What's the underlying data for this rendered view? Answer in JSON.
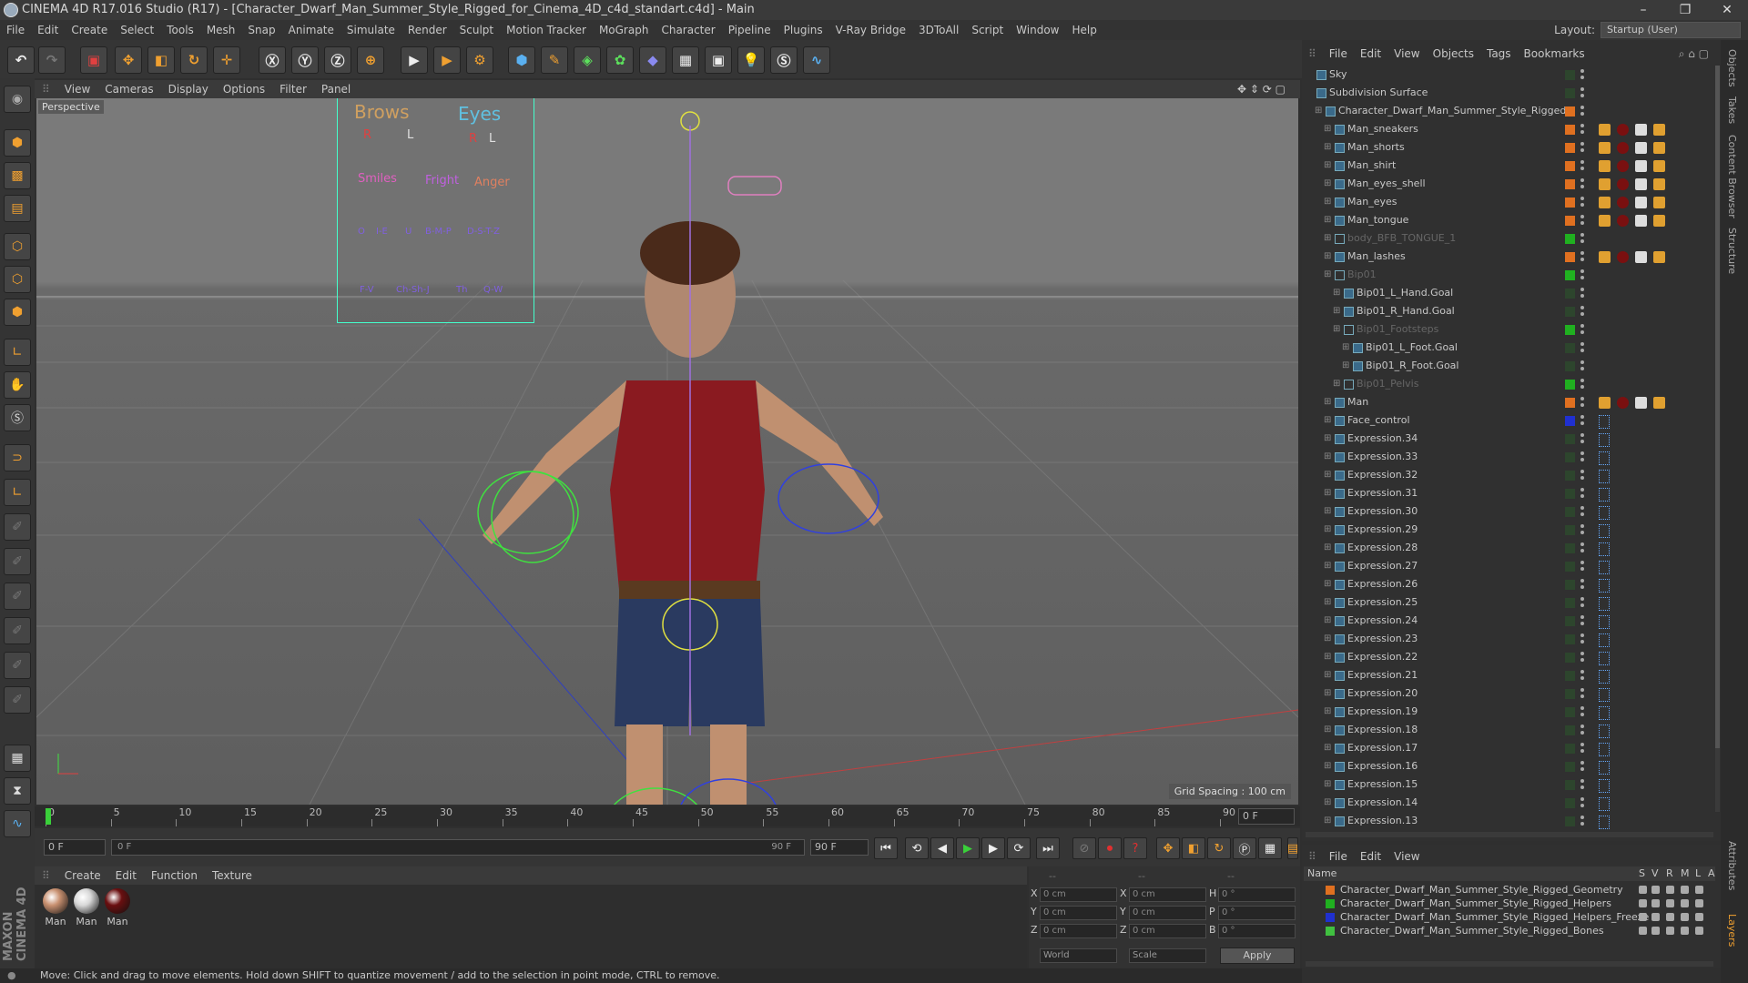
{
  "window": {
    "title": "CINEMA 4D R17.016 Studio (R17) - [Character_Dwarf_Man_Summer_Style_Rigged_for_Cinema_4D_c4d_standart.c4d] - Main",
    "controls": [
      "–",
      "❐",
      "✕"
    ]
  },
  "menu": [
    "File",
    "Edit",
    "Create",
    "Select",
    "Tools",
    "Mesh",
    "Snap",
    "Animate",
    "Simulate",
    "Render",
    "Sculpt",
    "Motion Tracker",
    "MoGraph",
    "Character",
    "Pipeline",
    "Plugins",
    "V-Ray Bridge",
    "3DToAll",
    "Script",
    "Window",
    "Help"
  ],
  "layout": {
    "label": "Layout:",
    "value": "Startup (User)"
  },
  "viewport": {
    "menu": [
      "View",
      "Cameras",
      "Display",
      "Options",
      "Filter",
      "Panel"
    ],
    "camera_label": "Perspective",
    "grid_spacing": "Grid Spacing : 100 cm",
    "face_controls": {
      "brows": "Brows",
      "eyes": "Eyes",
      "r1": "R",
      "l1": "L",
      "r2": "R",
      "l2": "L",
      "smiles": "Smiles",
      "fright": "Fright",
      "anger": "Anger",
      "phonemes1": [
        "O",
        "I-E",
        "U",
        "B-M-P",
        "D-S-T-Z"
      ],
      "phonemes2": [
        "F-V",
        "Ch-Sh-J",
        "Th",
        "Q-W"
      ]
    }
  },
  "timeline": {
    "ticks": [
      "0",
      "5",
      "10",
      "15",
      "20",
      "25",
      "30",
      "35",
      "40",
      "45",
      "50",
      "55",
      "60",
      "65",
      "70",
      "75",
      "80",
      "85",
      "90"
    ],
    "current_frame": "0 F",
    "start_field": "0 F",
    "range_start": "0 F",
    "range_end": "90 F",
    "end_field": "90 F"
  },
  "materials": {
    "menu": [
      "Create",
      "Edit",
      "Function",
      "Texture"
    ],
    "items": [
      {
        "label": "Man",
        "color": "#c89070"
      },
      {
        "label": "Man",
        "color": "#d8d8d8"
      },
      {
        "label": "Man",
        "color": "#6a0f10"
      }
    ]
  },
  "coords": {
    "header": [
      "--",
      "--",
      "--"
    ],
    "rows": [
      {
        "a": "X",
        "av": "0 cm",
        "b": "X",
        "bv": "0 cm",
        "c": "H",
        "cv": "0 °"
      },
      {
        "a": "Y",
        "av": "0 cm",
        "b": "Y",
        "bv": "0 cm",
        "c": "P",
        "cv": "0 °"
      },
      {
        "a": "Z",
        "av": "0 cm",
        "b": "Z",
        "bv": "0 cm",
        "c": "B",
        "cv": "0 °"
      }
    ],
    "space": "World",
    "mode": "Scale",
    "apply": "Apply"
  },
  "status": "Move: Click and drag to move elements. Hold down SHIFT to quantize movement / add to the selection in point mode, CTRL to remove.",
  "object_manager": {
    "menu": [
      "File",
      "Edit",
      "View",
      "Objects",
      "Tags",
      "Bookmarks"
    ],
    "objects": [
      {
        "name": "Sky",
        "indent": 0,
        "color": "",
        "dim": false
      },
      {
        "name": "Subdivision Surface",
        "indent": 0,
        "color": "",
        "dim": false
      },
      {
        "name": "Character_Dwarf_Man_Summer_Style_Rigged",
        "indent": 1,
        "color": "#e07020",
        "dim": false
      },
      {
        "name": "Man_sneakers",
        "indent": 2,
        "color": "#e07020",
        "dim": false
      },
      {
        "name": "Man_shorts",
        "indent": 2,
        "color": "#e07020",
        "dim": false
      },
      {
        "name": "Man_shirt",
        "indent": 2,
        "color": "#e07020",
        "dim": false
      },
      {
        "name": "Man_eyes_shell",
        "indent": 2,
        "color": "#e07020",
        "dim": false
      },
      {
        "name": "Man_eyes",
        "indent": 2,
        "color": "#e07020",
        "dim": false
      },
      {
        "name": "Man_tongue",
        "indent": 2,
        "color": "#e07020",
        "dim": false
      },
      {
        "name": "body_BFB_TONGUE_1",
        "indent": 2,
        "color": "#20b020",
        "dim": true
      },
      {
        "name": "Man_lashes",
        "indent": 2,
        "color": "#e07020",
        "dim": false
      },
      {
        "name": "Bip01",
        "indent": 2,
        "color": "#20b020",
        "dim": true
      },
      {
        "name": "Bip01_L_Hand.Goal",
        "indent": 3,
        "color": "",
        "dim": false
      },
      {
        "name": "Bip01_R_Hand.Goal",
        "indent": 3,
        "color": "",
        "dim": false
      },
      {
        "name": "Bip01_Footsteps",
        "indent": 3,
        "color": "#20b020",
        "dim": true
      },
      {
        "name": "Bip01_L_Foot.Goal",
        "indent": 4,
        "color": "",
        "dim": false
      },
      {
        "name": "Bip01_R_Foot.Goal",
        "indent": 4,
        "color": "",
        "dim": false
      },
      {
        "name": "Bip01_Pelvis",
        "indent": 3,
        "color": "#20b020",
        "dim": true
      },
      {
        "name": "Man",
        "indent": 2,
        "color": "#e07020",
        "dim": false
      },
      {
        "name": "Face_control",
        "indent": 2,
        "color": "#2030d0",
        "dim": false
      },
      {
        "name": "Expression.34",
        "indent": 2,
        "color": "",
        "dim": false
      },
      {
        "name": "Expression.33",
        "indent": 2,
        "color": "",
        "dim": false
      },
      {
        "name": "Expression.32",
        "indent": 2,
        "color": "",
        "dim": false
      },
      {
        "name": "Expression.31",
        "indent": 2,
        "color": "",
        "dim": false
      },
      {
        "name": "Expression.30",
        "indent": 2,
        "color": "",
        "dim": false
      },
      {
        "name": "Expression.29",
        "indent": 2,
        "color": "",
        "dim": false
      },
      {
        "name": "Expression.28",
        "indent": 2,
        "color": "",
        "dim": false
      },
      {
        "name": "Expression.27",
        "indent": 2,
        "color": "",
        "dim": false
      },
      {
        "name": "Expression.26",
        "indent": 2,
        "color": "",
        "dim": false
      },
      {
        "name": "Expression.25",
        "indent": 2,
        "color": "",
        "dim": false
      },
      {
        "name": "Expression.24",
        "indent": 2,
        "color": "",
        "dim": false
      },
      {
        "name": "Expression.23",
        "indent": 2,
        "color": "",
        "dim": false
      },
      {
        "name": "Expression.22",
        "indent": 2,
        "color": "",
        "dim": false
      },
      {
        "name": "Expression.21",
        "indent": 2,
        "color": "",
        "dim": false
      },
      {
        "name": "Expression.20",
        "indent": 2,
        "color": "",
        "dim": false
      },
      {
        "name": "Expression.19",
        "indent": 2,
        "color": "",
        "dim": false
      },
      {
        "name": "Expression.18",
        "indent": 2,
        "color": "",
        "dim": false
      },
      {
        "name": "Expression.17",
        "indent": 2,
        "color": "",
        "dim": false
      },
      {
        "name": "Expression.16",
        "indent": 2,
        "color": "",
        "dim": false
      },
      {
        "name": "Expression.15",
        "indent": 2,
        "color": "",
        "dim": false
      },
      {
        "name": "Expression.14",
        "indent": 2,
        "color": "",
        "dim": false
      },
      {
        "name": "Expression.13",
        "indent": 2,
        "color": "",
        "dim": false
      }
    ]
  },
  "layer_manager": {
    "menu": [
      "File",
      "Edit",
      "View"
    ],
    "columns": [
      "Name",
      "S",
      "V",
      "R",
      "M",
      "L",
      "A"
    ],
    "layers": [
      {
        "name": "Character_Dwarf_Man_Summer_Style_Rigged_Geometry",
        "color": "#e07020"
      },
      {
        "name": "Character_Dwarf_Man_Summer_Style_Rigged_Helpers",
        "color": "#20b020"
      },
      {
        "name": "Character_Dwarf_Man_Summer_Style_Rigged_Helpers_Freeze",
        "color": "#2030d0"
      },
      {
        "name": "Character_Dwarf_Man_Summer_Style_Rigged_Bones",
        "color": "#40c040"
      }
    ]
  },
  "right_tabs": [
    "Objects",
    "Takes",
    "Content Browser",
    "Structure",
    "Attributes",
    "Layers"
  ],
  "brand": "MAXON CINEMA 4D"
}
